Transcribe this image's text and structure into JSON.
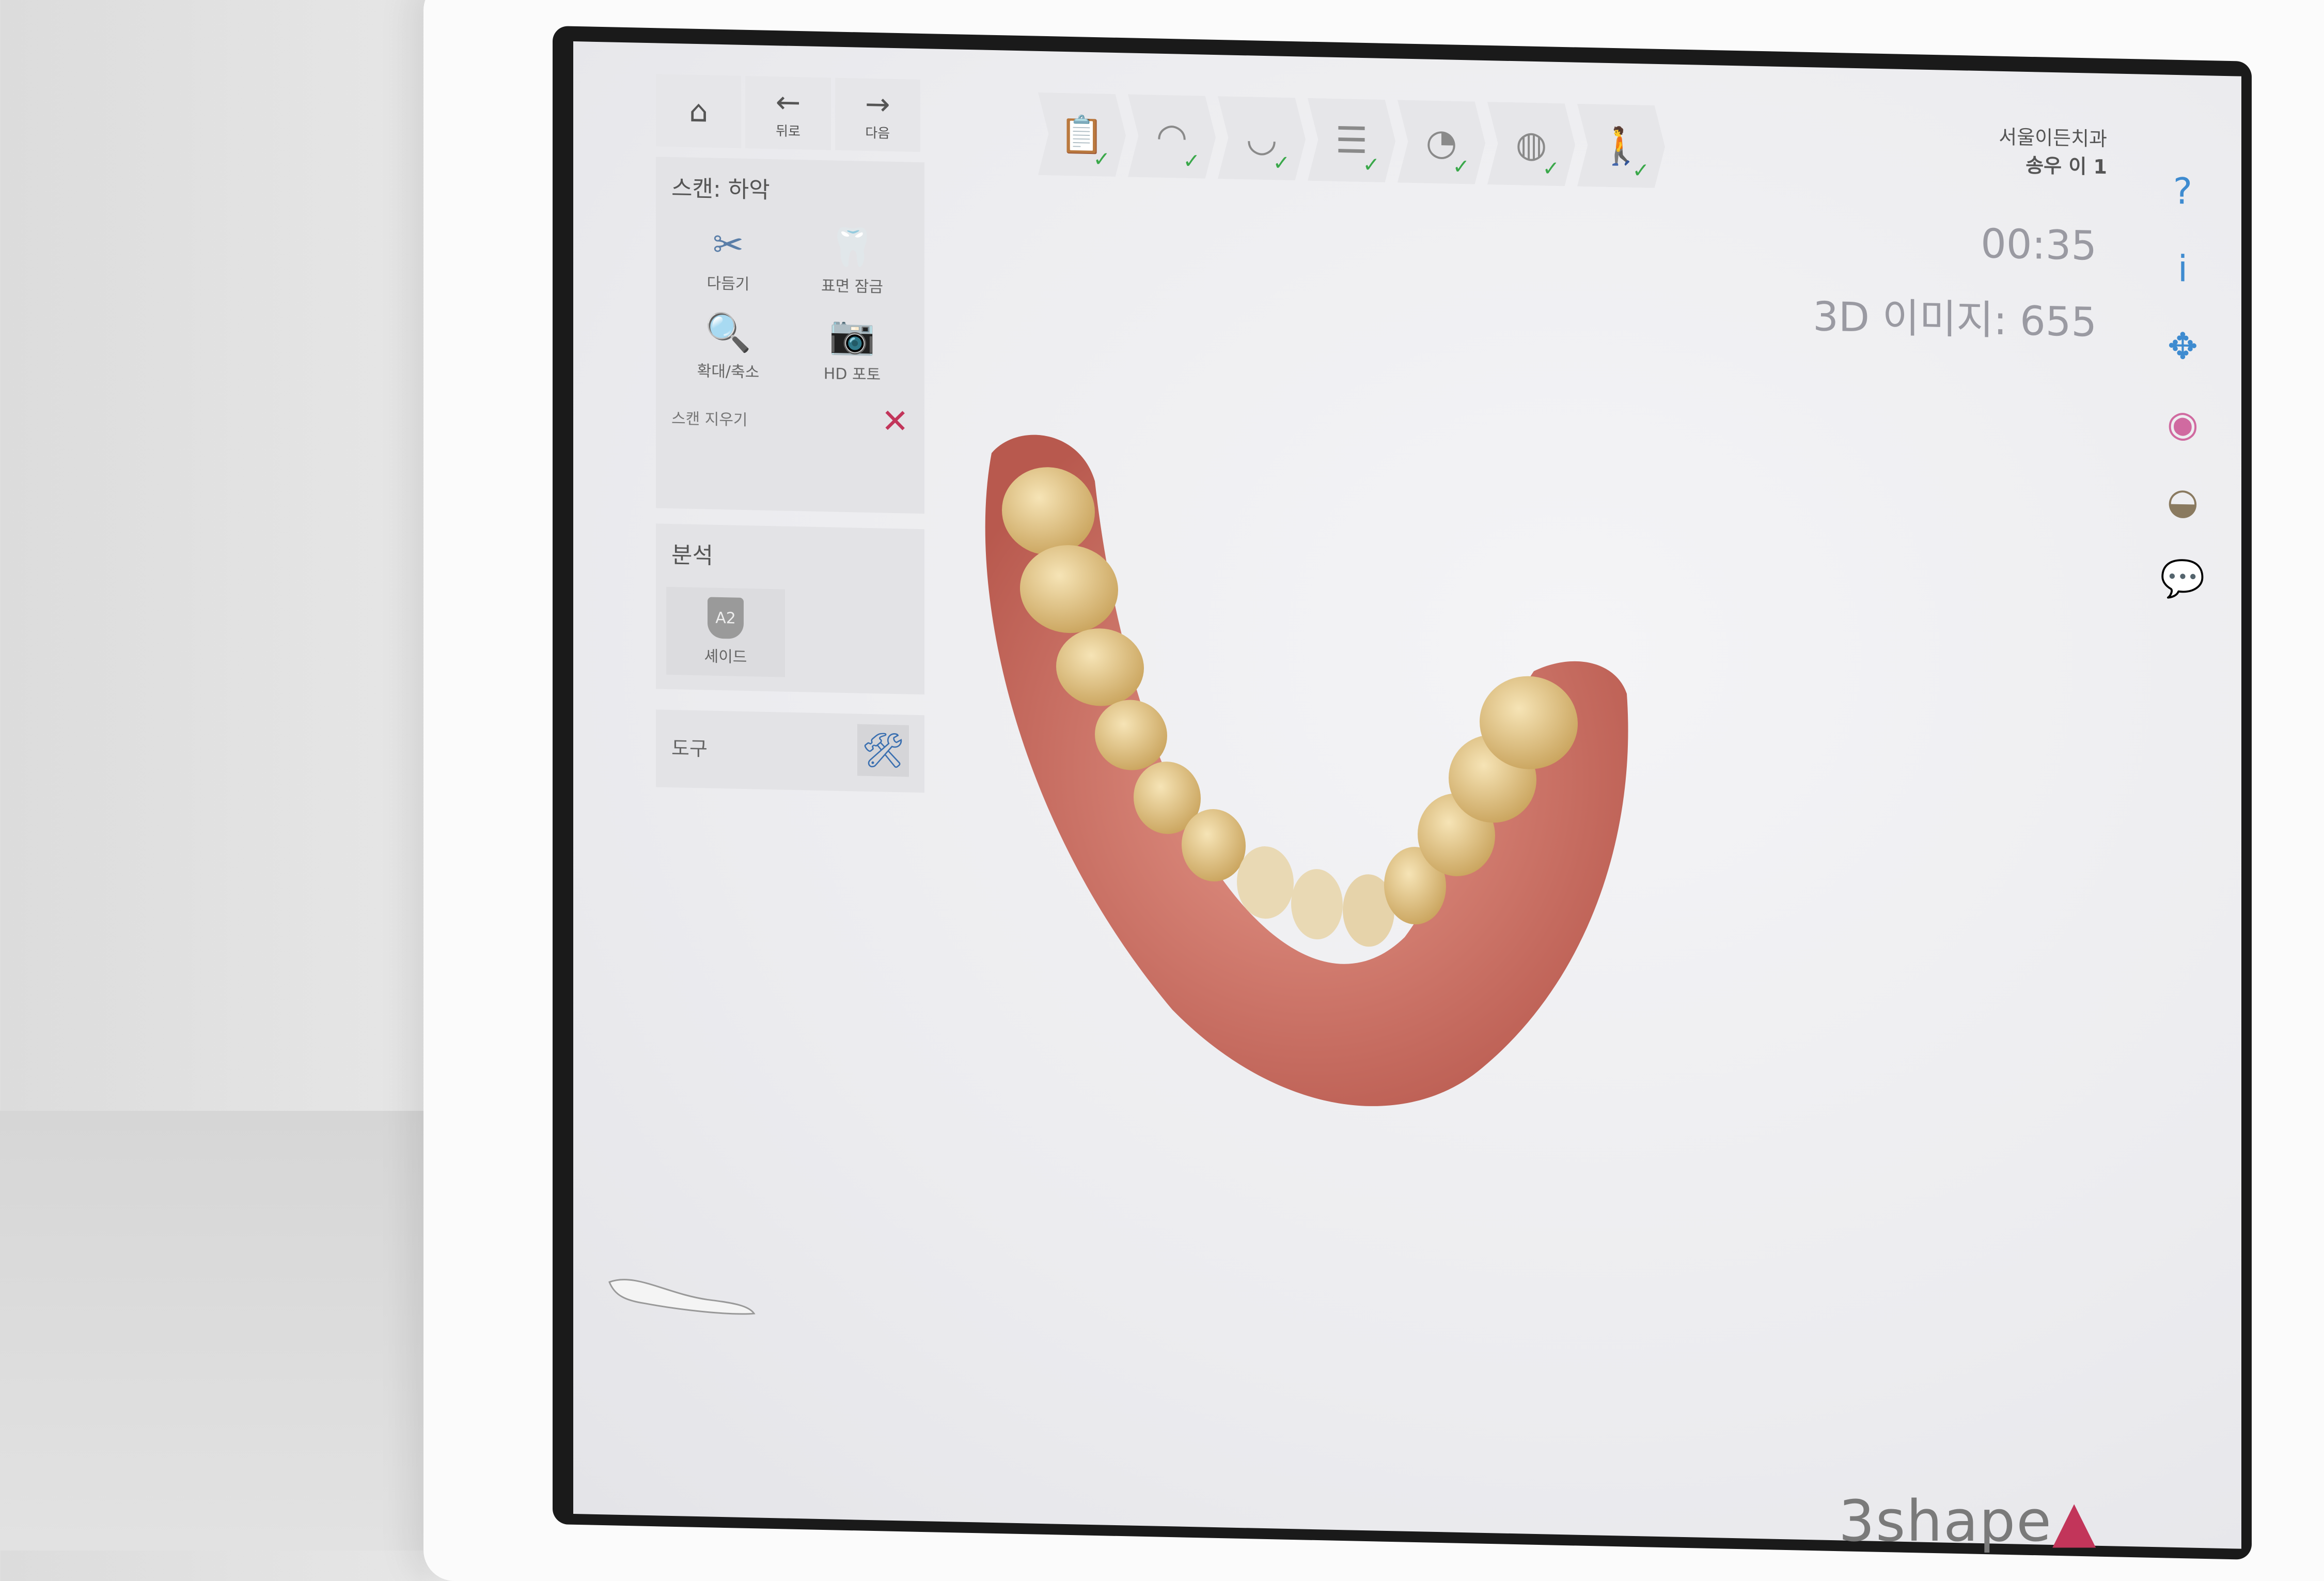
{
  "nav": {
    "back_label": "뒤로",
    "next_label": "다음",
    "home_glyph": "⌂",
    "back_glyph": "←",
    "next_glyph": "→"
  },
  "scan_panel": {
    "title": "스캔: 하악",
    "tools": [
      {
        "icon": "scissors-icon",
        "glyph": "✂",
        "label": "다듬기"
      },
      {
        "icon": "surface-lock-icon",
        "glyph": "🦷",
        "label": "표면 잠금"
      },
      {
        "icon": "magnifier-icon",
        "glyph": "🔍",
        "label": "확대/축소"
      },
      {
        "icon": "camera-icon",
        "glyph": "📷",
        "label": "HD 포토"
      }
    ],
    "erase_label": "스캔 지우기",
    "erase_glyph": "✕"
  },
  "analysis_panel": {
    "title": "분석",
    "shade_label": "셰이드",
    "shade_badge": "A2"
  },
  "tools_panel": {
    "title": "도구",
    "glyph": "🛠"
  },
  "workflow_steps": [
    {
      "icon": "order-form-icon",
      "glyph": "📋",
      "done": "✓"
    },
    {
      "icon": "upper-jaw-icon",
      "glyph": "◠",
      "done": "✓"
    },
    {
      "icon": "lower-jaw-icon",
      "glyph": "◡",
      "done": "✓"
    },
    {
      "icon": "bite-icon",
      "glyph": "☰",
      "done": "✓"
    },
    {
      "icon": "shade-tooth-icon",
      "glyph": "◔",
      "done": "✓"
    },
    {
      "icon": "tooth-icon",
      "glyph": "◍",
      "done": "✓"
    },
    {
      "icon": "patient-icon",
      "glyph": "🚶",
      "done": "✓"
    }
  ],
  "patient": {
    "clinic": "서울이든치과",
    "name": "송우 이 1"
  },
  "timer": "00:35",
  "image_count": "3D 이미지: 655",
  "right_toolbar": [
    {
      "icon": "help-icon",
      "glyph": "?"
    },
    {
      "icon": "info-icon",
      "glyph": "i"
    },
    {
      "icon": "move-icon",
      "glyph": "✥"
    },
    {
      "icon": "color-wheel-icon",
      "glyph": "◉"
    },
    {
      "icon": "tooth-view-icon",
      "glyph": "◒"
    },
    {
      "icon": "comment-icon",
      "glyph": "💬"
    }
  ],
  "brand": {
    "name": "3shape",
    "mark": "▲"
  },
  "colors": {
    "accent": "#3e8bd0",
    "erase": "#c2355a",
    "check": "#3aa84a",
    "gum": "#d9857a",
    "tooth": "#e8c98a"
  }
}
